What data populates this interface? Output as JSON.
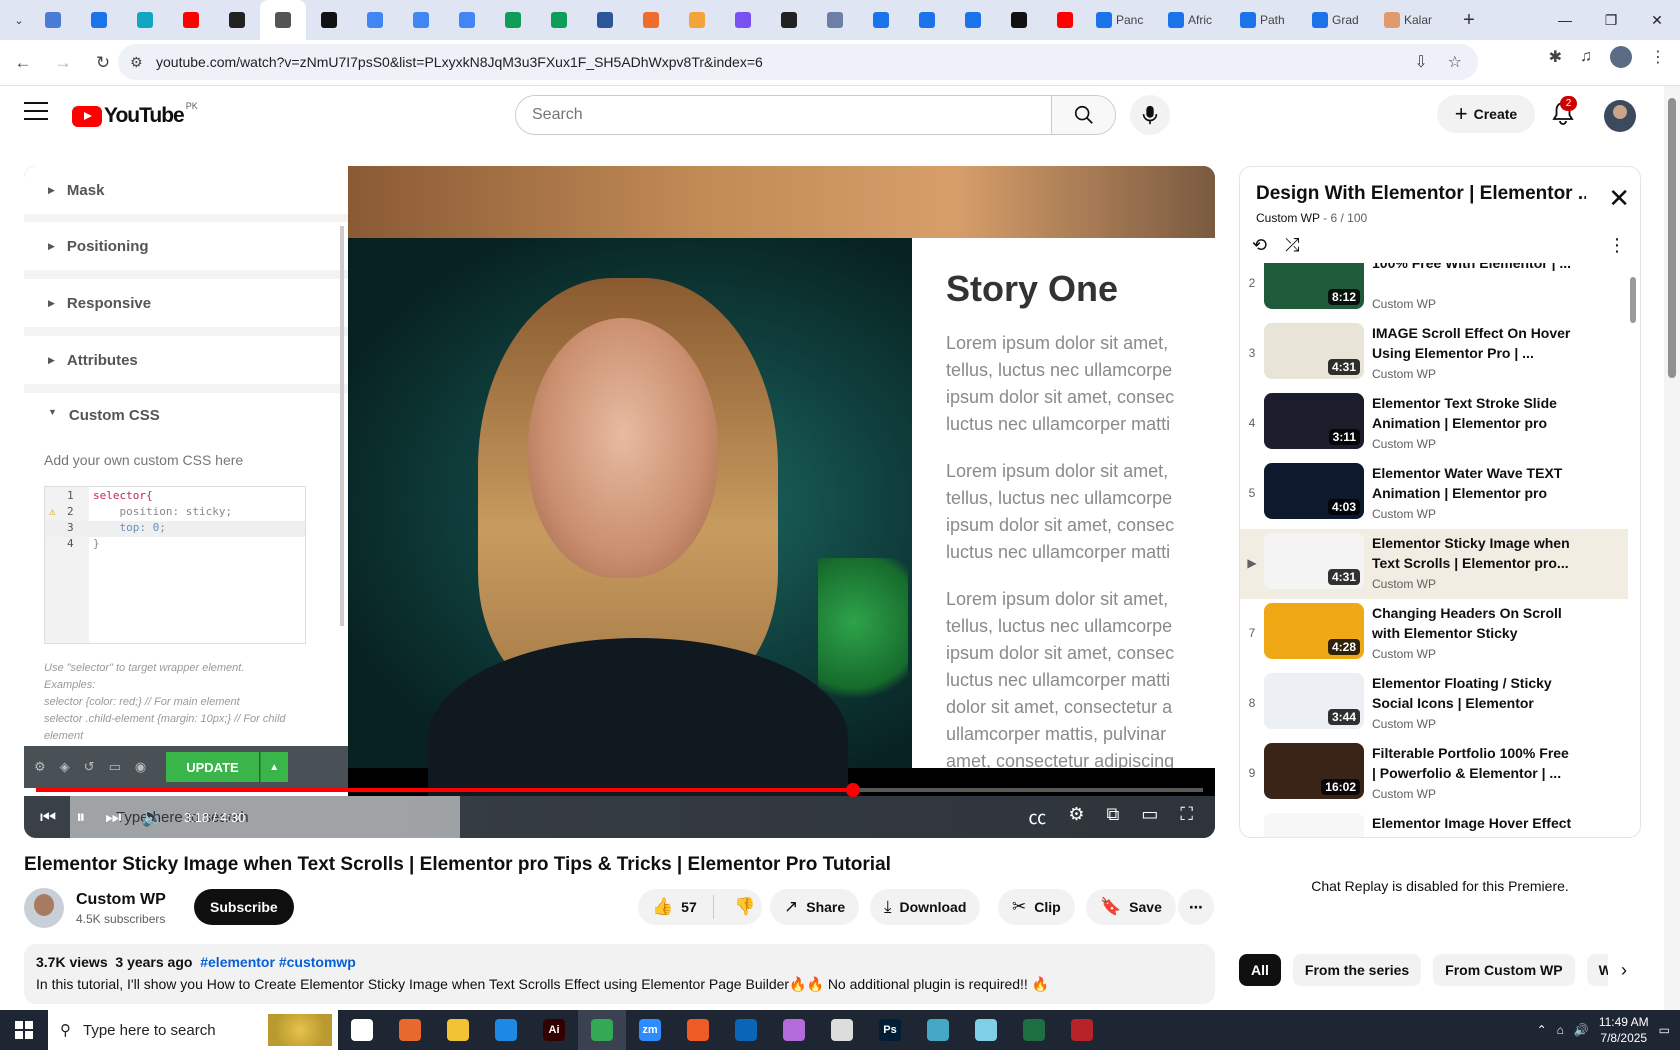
{
  "browser": {
    "tabs": [
      {
        "icon": "chrome-tab-icon",
        "color": "#4a7bd6",
        "title": ""
      },
      {
        "icon": "dribbble-icon",
        "color": "#1a73e8",
        "title": ""
      },
      {
        "icon": "gemini-icon",
        "color": "#12a5c4",
        "title": ""
      },
      {
        "icon": "youtube-icon",
        "color": "#ff0000",
        "title": ""
      },
      {
        "icon": "github-icon",
        "color": "#222222",
        "title": ""
      },
      {
        "icon": "audio-icon",
        "color": "#555555",
        "title": "",
        "active": true
      },
      {
        "icon": "bolt-icon",
        "color": "#111111",
        "title": ""
      },
      {
        "icon": "docs-icon",
        "color": "#4285f4",
        "title": ""
      },
      {
        "icon": "docs-icon",
        "color": "#4285f4",
        "title": ""
      },
      {
        "icon": "docs-icon",
        "color": "#4285f4",
        "title": ""
      },
      {
        "icon": "sheets-icon",
        "color": "#0f9d58",
        "title": ""
      },
      {
        "icon": "sheets-icon",
        "color": "#0f9d58",
        "title": ""
      },
      {
        "icon": "word-icon",
        "color": "#2b579a",
        "title": ""
      },
      {
        "icon": "wix-icon",
        "color": "#ef6c2c",
        "title": ""
      },
      {
        "icon": "bird-icon",
        "color": "#f2a33a",
        "title": ""
      },
      {
        "icon": "code-icon",
        "color": "#7a4ff3",
        "title": ""
      },
      {
        "icon": "code-icon",
        "color": "#222222",
        "title": ""
      },
      {
        "icon": "grid-icon",
        "color": "#6b7fa8",
        "title": ""
      },
      {
        "icon": "docs-icon",
        "color": "#1a73e8",
        "title": ""
      },
      {
        "icon": "docs-icon",
        "color": "#1a73e8",
        "title": ""
      },
      {
        "icon": "docs-icon",
        "color": "#1a73e8",
        "title": ""
      },
      {
        "icon": "medium-icon",
        "color": "#111111",
        "title": ""
      },
      {
        "icon": "youtube-icon",
        "color": "#ff0000",
        "title": ""
      }
    ],
    "wide_tabs": [
      {
        "icon": "docs-icon",
        "color": "#1a73e8",
        "title": "Panc"
      },
      {
        "icon": "docs-icon",
        "color": "#1a73e8",
        "title": "Afric"
      },
      {
        "icon": "docs-icon",
        "color": "#1a73e8",
        "title": "Path"
      },
      {
        "icon": "docs-icon",
        "color": "#1a73e8",
        "title": "Grad"
      },
      {
        "icon": "kalam-icon",
        "color": "#e39a6b",
        "title": "Kalar"
      }
    ],
    "url": "youtube.com/watch?v=zNmU7I7psS0&list=PLxyxkN8JqM3u3FXux1F_SH5ADhWxpv8Tr&index=6"
  },
  "yt": {
    "logo_word": "YouTube",
    "country": "PK",
    "search_placeholder": "Search",
    "create_label": "Create",
    "notif_count": "2"
  },
  "video_frame": {
    "editor_sections": [
      "Mask",
      "Positioning",
      "Responsive",
      "Attributes",
      "Custom CSS"
    ],
    "css_hint": "Add your own custom CSS here",
    "code_lines": [
      {
        "n": "1",
        "t": "selector{"
      },
      {
        "n": "2",
        "t": "    position: sticky;"
      },
      {
        "n": "3",
        "t": "    top: 0;"
      },
      {
        "n": "4",
        "t": "}"
      }
    ],
    "help_lines": [
      "Use \"selector\" to target wrapper element.",
      "Examples:",
      "selector {color: red;} // For main element",
      "selector .child-element {margin: 10px;} // For child",
      "element"
    ],
    "update_label": "UPDATE",
    "story_title": "Story One",
    "story_paras": [
      [
        "Lorem ipsum dolor sit amet,",
        "tellus, luctus nec ullamcorpe",
        "ipsum dolor sit amet, consec",
        "luctus nec ullamcorper matti"
      ],
      [
        "Lorem ipsum dolor sit amet,",
        "tellus, luctus nec ullamcorpe",
        "ipsum dolor sit amet, consec",
        "luctus nec ullamcorper matti"
      ],
      [
        "Lorem ipsum dolor sit amet,",
        "tellus, luctus nec ullamcorpe",
        "ipsum dolor sit amet, consec",
        "luctus nec ullamcorper matti",
        "dolor sit amet, consectetur a",
        "ullamcorper mattis, pulvinar",
        "amet, consectetur adipiscing"
      ]
    ],
    "underlay_search": "Type here to search"
  },
  "player": {
    "time": "3:18 / 4:30",
    "progress": 0.7
  },
  "video": {
    "title": "Elementor Sticky Image when Text Scrolls | Elementor pro Tips & Tricks | Elementor Pro Tutorial",
    "channel": "Custom WP",
    "subscribers": "4.5K subscribers",
    "subscribe_label": "Subscribe",
    "likes": "57",
    "share_label": "Share",
    "download_label": "Download",
    "clip_label": "Clip",
    "save_label": "Save",
    "views": "3.7K views",
    "age": "3 years ago",
    "tags": "#elementor #customwp",
    "description": "In this tutorial, I'll show you How to Create Elementor Sticky Image when Text Scrolls Effect using Elementor Page Builder🔥🔥 No additional plugin is required!! 🔥"
  },
  "playlist": {
    "title": "Design With Elementor | Elementor ...",
    "owner": "Custom WP",
    "position": "- 6 / 100",
    "items": [
      {
        "idx": "2",
        "title": "100% Free With Elementor | ...",
        "channel": "Custom WP",
        "duration": "8:12",
        "thumb": "#1f5a3a"
      },
      {
        "idx": "3",
        "title": "IMAGE Scroll Effect On Hover Using Elementor Pro | ...",
        "channel": "Custom WP",
        "duration": "4:31",
        "thumb": "#e9e4d8"
      },
      {
        "idx": "4",
        "title": "Elementor Text Stroke Slide Animation | Elementor pro Tip...",
        "channel": "Custom WP",
        "duration": "3:11",
        "thumb": "#1b1e2a"
      },
      {
        "idx": "5",
        "title": "Elementor Water Wave TEXT Animation | Elementor pro Tip...",
        "channel": "Custom WP",
        "duration": "4:03",
        "thumb": "#0d1a2e"
      },
      {
        "idx": "▶",
        "title": "Elementor Sticky Image when Text Scrolls | Elementor pro...",
        "channel": "Custom WP",
        "duration": "4:31",
        "thumb": "#f4f4f4",
        "active": true
      },
      {
        "idx": "7",
        "title": "Changing Headers On Scroll with Elementor Sticky Header...",
        "channel": "Custom WP",
        "duration": "4:28",
        "thumb": "#f0a814"
      },
      {
        "idx": "8",
        "title": "Elementor Floating / Sticky Social Icons | Elementor Pro...",
        "channel": "Custom WP",
        "duration": "3:44",
        "thumb": "#eceff3"
      },
      {
        "idx": "9",
        "title": "Filterable Portfolio 100% Free | Powerfolio & Elementor | ...",
        "channel": "Custom WP",
        "duration": "16:02",
        "thumb": "#3a2418"
      },
      {
        "idx": "10",
        "title": "Elementor Image Hover Effect | WordPress Elementor Pro...",
        "channel": "Custom WP",
        "duration": "",
        "thumb": "#f7f7f7"
      }
    ]
  },
  "chat_message": "Chat Replay is disabled for this Premiere.",
  "chips": [
    "All",
    "From the series",
    "From Custom WP",
    "Wo"
  ],
  "taskbar": {
    "search_placeholder": "Type here to search",
    "time": "11:49 AM",
    "date": "7/8/2025",
    "apps": [
      {
        "icon": "task-view-icon",
        "color": "#ffffff",
        "label": ""
      },
      {
        "icon": "firefox-icon",
        "color": "#e8692d",
        "label": ""
      },
      {
        "icon": "file-explorer-icon",
        "color": "#f1c232",
        "label": ""
      },
      {
        "icon": "vscode-icon",
        "color": "#1e88e5",
        "label": ""
      },
      {
        "icon": "illustrator-icon",
        "color": "#330000",
        "label": "Ai"
      },
      {
        "icon": "chrome-icon",
        "color": "#34a853",
        "label": "",
        "active": true
      },
      {
        "icon": "zoom-icon",
        "color": "#2d8cff",
        "label": "zm"
      },
      {
        "icon": "postman-icon",
        "color": "#ef5b25",
        "label": ""
      },
      {
        "icon": "outlook-icon",
        "color": "#0a64b8",
        "label": ""
      },
      {
        "icon": "photos-icon",
        "color": "#b26bd8",
        "label": ""
      },
      {
        "icon": "pen-icon",
        "color": "#dddddd",
        "label": ""
      },
      {
        "icon": "photoshop-icon",
        "color": "#001e36",
        "label": "Ps"
      },
      {
        "icon": "app-icon",
        "color": "#46a7c4",
        "label": ""
      },
      {
        "icon": "notepad-icon",
        "color": "#7fd0e6",
        "label": ""
      },
      {
        "icon": "excel-icon",
        "color": "#1d6f42",
        "label": ""
      },
      {
        "icon": "filezilla-icon",
        "color": "#b8232a",
        "label": ""
      }
    ]
  }
}
